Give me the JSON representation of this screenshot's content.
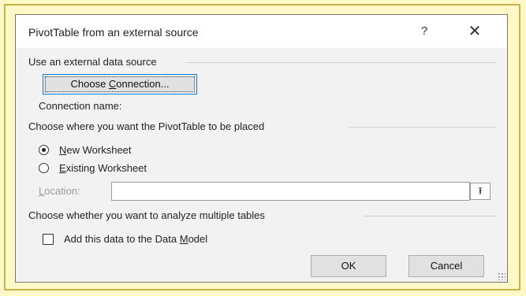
{
  "dialog": {
    "title": "PivotTable from an external source",
    "help": "?",
    "close": "✕"
  },
  "source": {
    "heading": "Use an external data source",
    "choose_button": {
      "before": "Choose ",
      "accel": "C",
      "after": "onnection..."
    },
    "connection_label": "Connection name:"
  },
  "placement": {
    "heading": "Choose where you want the PivotTable to be placed",
    "new_worksheet": {
      "accel": "N",
      "rest": "ew Worksheet",
      "selected": true
    },
    "existing_worksheet": {
      "accel": "E",
      "rest": "xisting Worksheet",
      "selected": false
    },
    "location": {
      "accel": "L",
      "rest": "ocation:",
      "value": ""
    },
    "collapse_icon": "⭱"
  },
  "analyze": {
    "heading": "Choose whether you want to analyze multiple tables",
    "data_model": {
      "before": "Add this data to the Data ",
      "accel": "M",
      "after": "odel",
      "checked": false
    }
  },
  "buttons": {
    "ok": "OK",
    "cancel": "Cancel"
  },
  "colors": {
    "page_bg": "#fdf8c6",
    "frame": "#c9b24a",
    "dialog_bg": "#f2f2f2",
    "focus": "#0078d7"
  }
}
